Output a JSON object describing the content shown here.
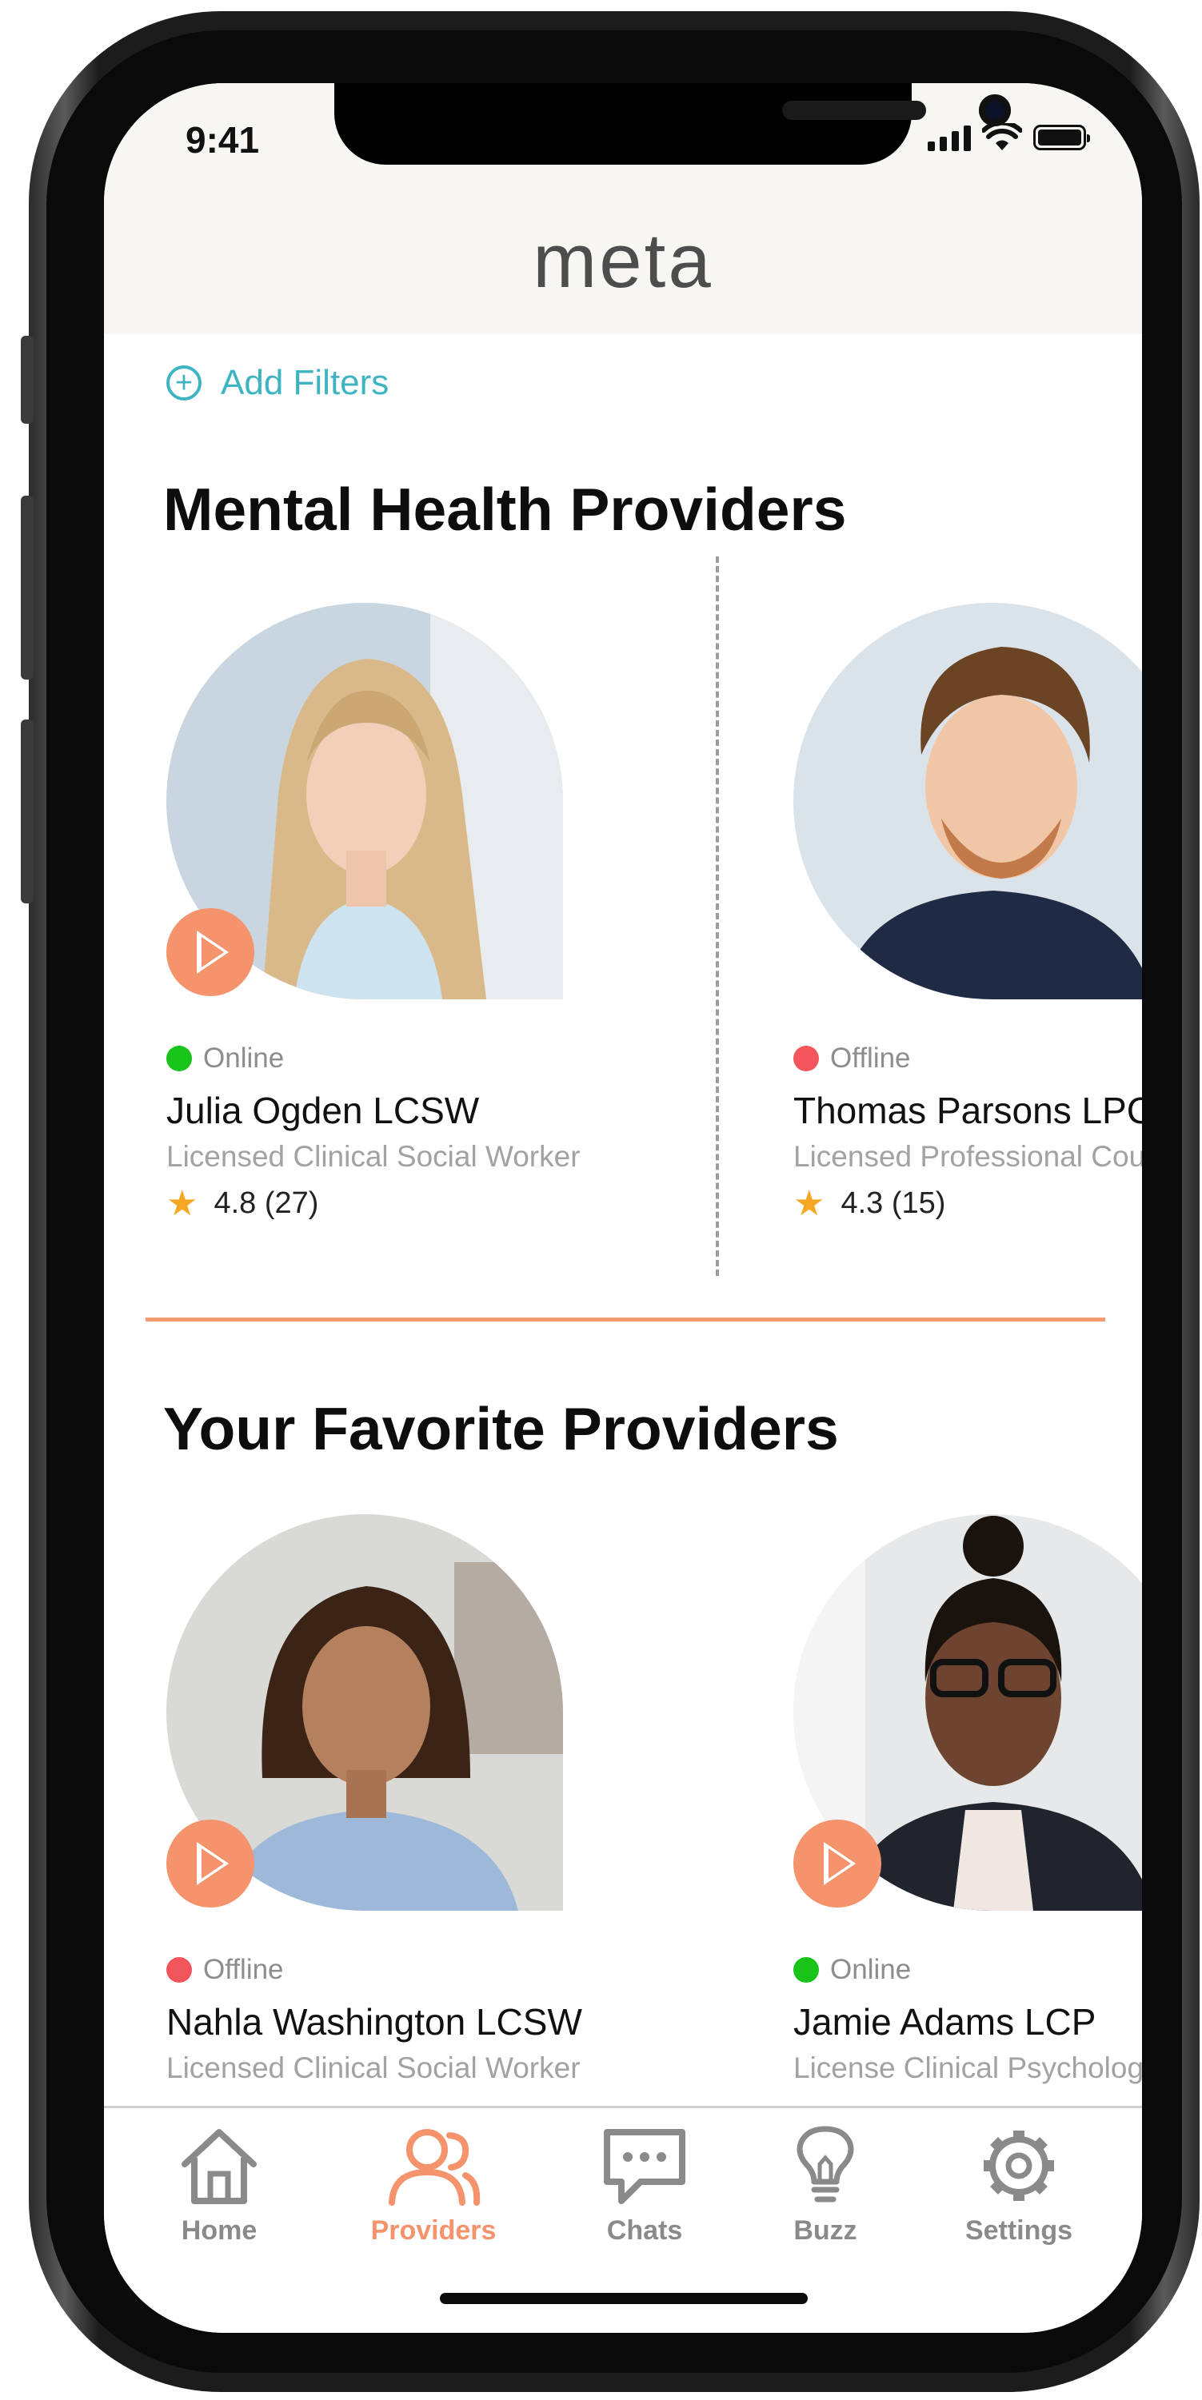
{
  "status_bar": {
    "time": "9:41"
  },
  "header": {
    "logo": "meta"
  },
  "filters": {
    "icon": "plus-circle-icon",
    "label": "Add Filters"
  },
  "sections": {
    "mental": {
      "title": "Mental Health Providers",
      "providers": [
        {
          "status": "Online",
          "status_color": "#17c417",
          "name": "Julia Ogden LCSW",
          "role": "Licensed Clinical Social Worker",
          "rating": "4.8 (27)"
        },
        {
          "status": "Offline",
          "status_color": "#f2555c",
          "name": "Thomas Parsons LPC",
          "role": "Licensed Professional Counselor",
          "rating": "4.3 (15)"
        }
      ]
    },
    "favorites": {
      "title": "Your Favorite Providers",
      "providers": [
        {
          "status": "Offline",
          "status_color": "#f2555c",
          "name": "Nahla Washington LCSW",
          "role": "Licensed Clinical Social Worker"
        },
        {
          "status": "Online",
          "status_color": "#17c417",
          "name": "Jamie Adams LCP",
          "role": "License Clinical Psychologist"
        }
      ]
    }
  },
  "tabs": [
    {
      "label": "Home",
      "icon": "home-icon",
      "active": false
    },
    {
      "label": "Providers",
      "icon": "users-icon",
      "active": true
    },
    {
      "label": "Chats",
      "icon": "chat-bubble-icon",
      "active": false
    },
    {
      "label": "Buzz",
      "icon": "lightbulb-icon",
      "active": false
    },
    {
      "label": "Settings",
      "icon": "gear-icon",
      "active": false
    }
  ],
  "colors": {
    "accent": "#f5936d",
    "link": "#3eb4c2",
    "tab_inactive": "#8a8a8a",
    "online": "#17c417",
    "offline": "#f2555c"
  }
}
